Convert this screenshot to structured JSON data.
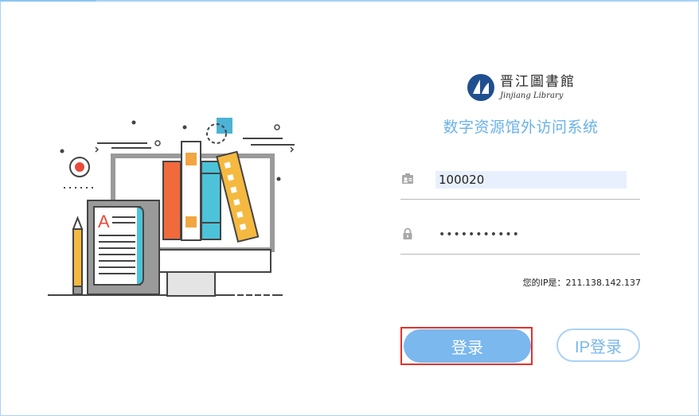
{
  "header": {
    "logo_cn": "晋江圖書館",
    "logo_en": "Jinjiang Library",
    "system_title": "数字资源馆外访问系统"
  },
  "form": {
    "username_value": "100020",
    "password_value": "•••••••••••",
    "username_icon": "id-card-icon",
    "password_icon": "lock-icon"
  },
  "ip_info": "您的IP是：211.138.142.137",
  "buttons": {
    "login_label": "登录",
    "ip_login_label": "IP登录"
  },
  "colors": {
    "accent": "#7ab8ee",
    "title": "#69b2e8",
    "highlight_border": "#e5302b"
  }
}
